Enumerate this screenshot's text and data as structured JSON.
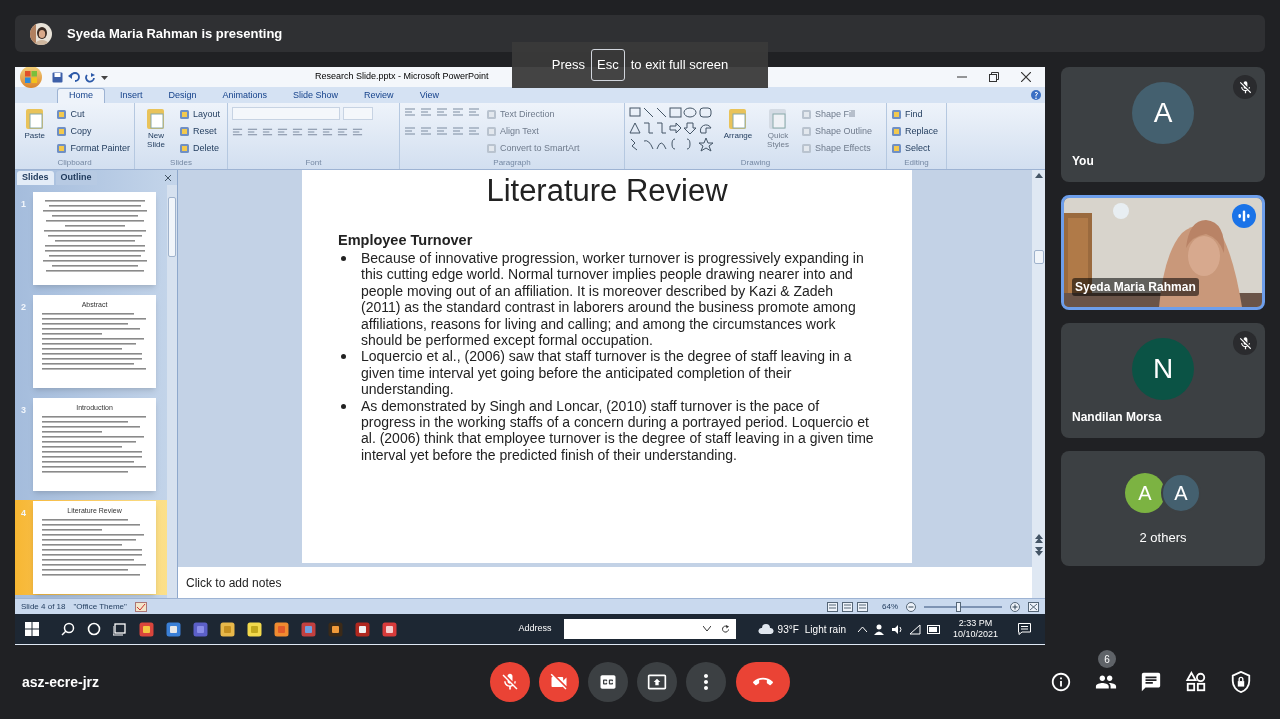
{
  "presenter_banner": {
    "text": "Syeda Maria Rahman is presenting"
  },
  "fullscreen_hint": {
    "before": "Press",
    "key": "Esc",
    "after": "to exit full screen"
  },
  "powerpoint": {
    "title": "Research Slide.pptx - Microsoft PowerPoint",
    "ribbon_tabs": [
      {
        "label": "Home",
        "selected": true
      },
      {
        "label": "Insert",
        "selected": false
      },
      {
        "label": "Design",
        "selected": false
      },
      {
        "label": "Animations",
        "selected": false
      },
      {
        "label": "Slide Show",
        "selected": false
      },
      {
        "label": "Review",
        "selected": false
      },
      {
        "label": "View",
        "selected": false
      }
    ],
    "ribbon_groups": [
      {
        "name": "Clipboard",
        "kind": "plain",
        "items": [
          {
            "label": "Paste",
            "kind": "large",
            "disabled": false
          },
          {
            "label": "Cut",
            "kind": "small",
            "disabled": false
          },
          {
            "label": "Copy",
            "kind": "small",
            "disabled": false
          },
          {
            "label": "Format Painter",
            "kind": "small",
            "disabled": false
          }
        ]
      },
      {
        "name": "Slides",
        "kind": "plain",
        "items": [
          {
            "label": "New Slide",
            "kind": "large",
            "disabled": false
          },
          {
            "label": "Layout",
            "kind": "small",
            "disabled": false
          },
          {
            "label": "Reset",
            "kind": "small",
            "disabled": false
          },
          {
            "label": "Delete",
            "kind": "small",
            "disabled": false
          }
        ]
      },
      {
        "name": "Font",
        "kind": "font"
      },
      {
        "name": "Paragraph",
        "kind": "paragraph",
        "items": [
          {
            "label": "Text Direction",
            "kind": "small",
            "disabled": true
          },
          {
            "label": "Align Text",
            "kind": "small",
            "disabled": true
          },
          {
            "label": "Convert to SmartArt",
            "kind": "small",
            "disabled": true
          }
        ]
      },
      {
        "name": "Drawing",
        "kind": "drawing",
        "items": [
          {
            "label": "Arrange",
            "kind": "large",
            "disabled": false
          },
          {
            "label": "Quick Styles",
            "kind": "large",
            "disabled": true
          },
          {
            "label": "Shape Fill",
            "kind": "small",
            "disabled": true
          },
          {
            "label": "Shape Outline",
            "kind": "small",
            "disabled": true
          },
          {
            "label": "Shape Effects",
            "kind": "small",
            "disabled": true
          }
        ]
      },
      {
        "name": "Editing",
        "kind": "plain",
        "items": [
          {
            "label": "Find",
            "kind": "small",
            "disabled": false
          },
          {
            "label": "Replace",
            "kind": "small",
            "disabled": false
          },
          {
            "label": "Select",
            "kind": "small",
            "disabled": false
          }
        ]
      }
    ],
    "pane_tabs": [
      {
        "label": "Slides",
        "selected": true
      },
      {
        "label": "Outline",
        "selected": false
      }
    ],
    "slides": [
      {
        "number": "1",
        "selected": false
      },
      {
        "number": "2",
        "title": "Abstract",
        "selected": false
      },
      {
        "number": "3",
        "title": "Introduction",
        "selected": false
      },
      {
        "number": "4",
        "title": "Literature Review",
        "selected": true
      }
    ],
    "slide": {
      "title": "Literature Review",
      "heading": "Employee Turnover",
      "bullets": [
        "Because of innovative progression, worker turnover is progressively expanding in this cutting edge world. Normal turnover implies people drawing nearer into and people moving out of an affiliation. It is moreover described by Kazi & Zadeh (2011) as the standard contrast in laborers around the business promote among affiliations, reasons for living and calling; and among the circumstances work should be performed except formal occupation.",
        "Loquercio et al., (2006) saw that staff turnover is the degree of staff leaving in a given time interval yet going before the anticipated completion of their understanding.",
        "As demonstrated by Singh and Loncar, (2010) staff turnover is the pace of progress in the working staffs of a concern during a portrayed period. Loquercio et al. (2006) think that employee turnover is the degree of staff leaving in a given time interval yet before the predicted finish of their understanding."
      ]
    },
    "notes": {
      "text": "Click to add notes"
    },
    "status_bar": {
      "slide_info": "Slide 4 of 18",
      "theme": "\"Office Theme\"",
      "zoom": {
        "reading": "64%",
        "level": 0.43
      }
    }
  },
  "taskbar": {
    "address_label": "Address",
    "temperature": "93°F",
    "weather": "Light rain",
    "time": "2:33 PM",
    "date": "10/10/2021"
  },
  "participants": [
    {
      "kind": "avatar",
      "name": "You",
      "initial": "A",
      "color": "#44606f",
      "muted": true,
      "speaking": false
    },
    {
      "kind": "video",
      "name": "Syeda Maria Rahman",
      "muted": false,
      "speaking": true
    },
    {
      "kind": "avatar",
      "name": "Nandilan Morsa",
      "initial": "N",
      "color": "#0b5345",
      "muted": true,
      "speaking": false
    },
    {
      "kind": "group",
      "name": "2 others",
      "muted": false,
      "speaking": false,
      "avatars": [
        {
          "initial": "A",
          "color": "#7cb342"
        },
        {
          "initial": "A",
          "color": "#44606f"
        }
      ]
    }
  ],
  "meeting": {
    "code": "asz-ecre-jrz",
    "controls": [
      {
        "kind": "mic",
        "on": false
      },
      {
        "kind": "camera",
        "on": false
      },
      {
        "kind": "captions",
        "on": false
      },
      {
        "kind": "present"
      },
      {
        "kind": "more"
      },
      {
        "kind": "leave"
      }
    ],
    "side_buttons": [
      {
        "kind": "info"
      },
      {
        "kind": "people",
        "badge": "6"
      },
      {
        "kind": "chat"
      },
      {
        "kind": "activities"
      },
      {
        "kind": "safety"
      }
    ]
  }
}
